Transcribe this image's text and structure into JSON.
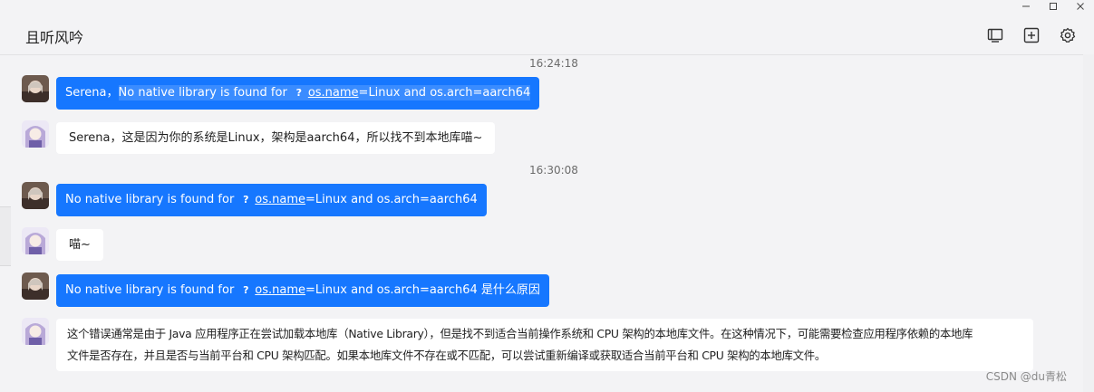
{
  "header": {
    "title": "且听风吟"
  },
  "timestamps": [
    "16:24:18",
    "16:30:08"
  ],
  "messages": [
    {
      "type": "sent",
      "prefix": "Serena，",
      "part1": "No native library is found for",
      "link": "os.name",
      "part2": "=Linux and os.arch=aarch64"
    },
    {
      "type": "recv",
      "text": "Serena，这是因为你的系统是Linux，架构是aarch64，所以找不到本地库喵~"
    },
    {
      "type": "sent",
      "part1": "No native library is found for",
      "link": "os.name",
      "part2": "=Linux and os.arch=aarch64"
    },
    {
      "type": "recv",
      "text": "喵~"
    },
    {
      "type": "sent",
      "part1": "No native library is found for",
      "link": "os.name",
      "part2": "=Linux and os.arch=aarch64 是什么原因"
    },
    {
      "type": "recv",
      "line1": "这个错误通常是由于 Java 应用程序正在尝试加载本地库（Native Library），但是找不到适合当前操作系统和 CPU 架构的本地库文件。在这种情况下，可能需要检查应用程序依赖的本地库",
      "line2": "文件是否存在，并且是否与当前平台和 CPU 架构匹配。如果本地库文件不存在或不匹配，可以尝试重新编译或获取适合当前平台和 CPU 架构的本地库文件。"
    }
  ],
  "question_mark": "?",
  "watermark": "CSDN @du青松",
  "icons": {
    "window": [
      "minimize-icon",
      "maximize-icon",
      "close-icon"
    ],
    "toolbar": [
      "screen-share-icon",
      "add-icon",
      "settings-icon"
    ]
  },
  "colors": {
    "sent_bubble": "#1677ff",
    "recv_bubble": "#ffffff",
    "background": "#f3f3f5"
  }
}
